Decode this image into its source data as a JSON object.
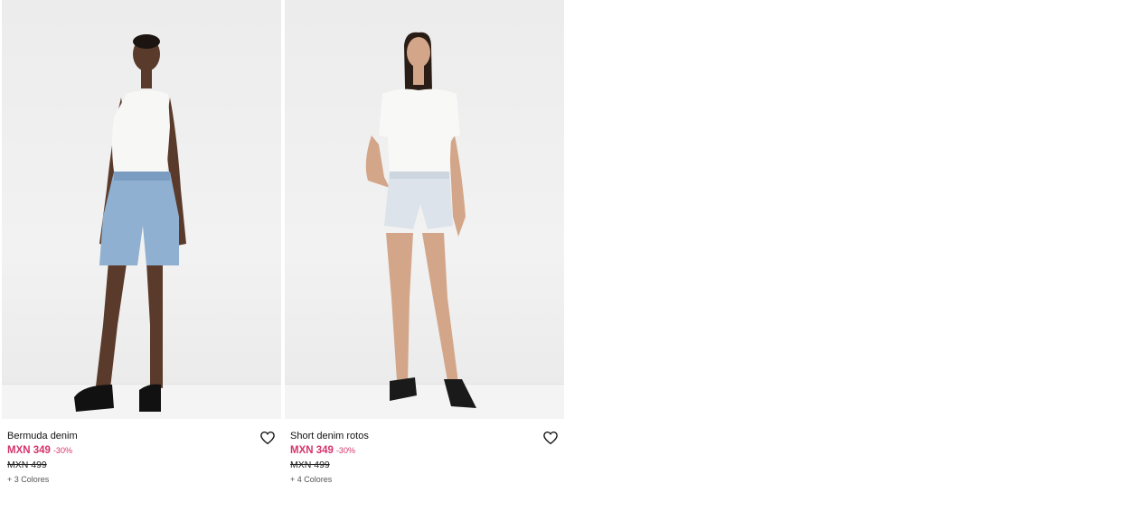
{
  "products": [
    {
      "name": "Bermuda denim",
      "price": "MXN 349",
      "discount": "-30%",
      "old_price": "MXN 499",
      "colors": "+ 3 Colores",
      "image_icon": "model-bermuda-photo",
      "accent": "#d6336c"
    },
    {
      "name": "Short denim rotos",
      "price": "MXN 349",
      "discount": "-30%",
      "old_price": "MXN 499",
      "colors": "+ 4 Colores",
      "image_icon": "model-short-photo",
      "accent": "#d6336c"
    }
  ]
}
